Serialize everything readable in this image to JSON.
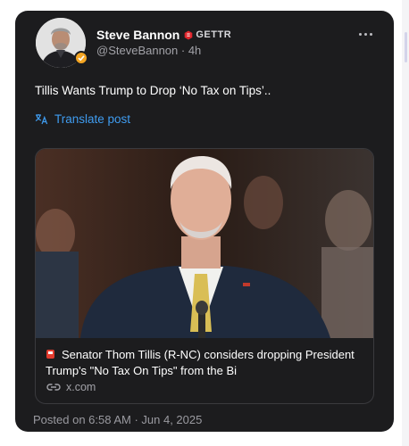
{
  "post": {
    "author": {
      "display_name": "Steve Bannon",
      "platform_badge": "GETTR",
      "handle_time": "@SteveBannon · 4h"
    },
    "text": "Tillis Wants Trump to Drop ‘No Tax on Tips’..",
    "translate_label": "Translate post",
    "link_preview": {
      "title": "Senator Thom Tillis (R-NC) considers dropping President Trump's \"No Tax On Tips\" from the Bi",
      "domain": "x.com"
    },
    "timestamp": "Posted on 6:58 AM · Jun 4, 2025"
  },
  "icons": {
    "more": "more-dots-icon",
    "translate": "translate-icon",
    "link": "link-icon",
    "badge": "verified-badge-icon",
    "gettr": "gettr-logo-icon",
    "flag": "red-flag-emoji-icon"
  },
  "colors": {
    "card_background": "#1c1c1e",
    "accent_link": "#3f9cf0",
    "secondary_text": "#a2a2a8",
    "gettr_red": "#e0262d"
  }
}
